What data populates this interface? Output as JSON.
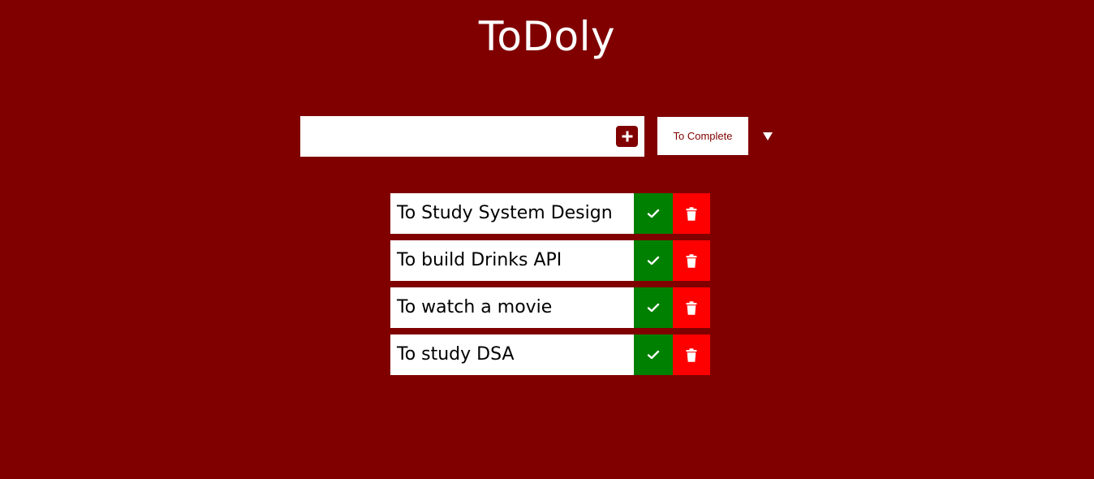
{
  "app": {
    "title": "ToDoly"
  },
  "input": {
    "value": "",
    "placeholder": "",
    "add_icon": "plus-square-icon"
  },
  "filter": {
    "selected": "To Complete",
    "arrow_icon": "caret-down-icon"
  },
  "todos": [
    {
      "text": "To Study System Design"
    },
    {
      "text": "To build Drinks API"
    },
    {
      "text": "To watch a movie"
    },
    {
      "text": "To study DSA"
    }
  ],
  "icons": {
    "complete": "check-icon",
    "delete": "trash-icon"
  },
  "colors": {
    "background": "#800000",
    "complete": "#008000",
    "delete": "#ff0000",
    "text": "#000000",
    "surface": "#ffffff"
  }
}
